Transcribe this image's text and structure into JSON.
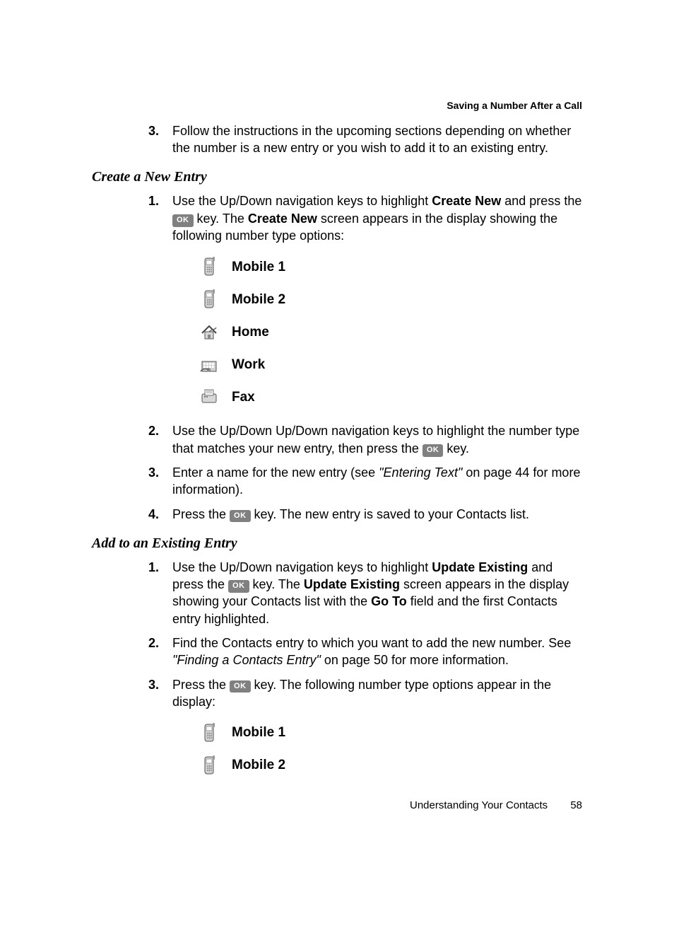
{
  "header": {
    "chapter_title": "Saving a Number After a Call"
  },
  "top_step": {
    "num": "3.",
    "text_before": "Follow the instructions in the upcoming sections depending on whether the number is a new entry or you wish to add it to an existing entry."
  },
  "section_a": {
    "heading": "Create a New Entry",
    "step1": {
      "num": "1.",
      "part1": "Use the Up/Down navigation keys to highlight ",
      "bold1": "Create New",
      "part2": " and press the ",
      "ok": "OK",
      "part3": " key. The ",
      "bold2": "Create New",
      "part4": " screen appears in the display showing the following number type options:"
    },
    "icons": {
      "mobile1": "Mobile 1",
      "mobile2": "Mobile 2",
      "home": "Home",
      "work": "Work",
      "fax": "Fax"
    },
    "step2": {
      "num": "2.",
      "part1": "Use the Up/Down Up/Down navigation keys to highlight the number type that matches your new entry, then press the ",
      "ok": "OK",
      "part2": " key."
    },
    "step3": {
      "num": "3.",
      "part1": "Enter a name for the new entry (see ",
      "ref": "\"Entering Text\"",
      "part2": " on page 44 for more information)."
    },
    "step4": {
      "num": "4.",
      "part1": "Press the ",
      "ok": "OK",
      "part2": " key. The new entry is saved to your Contacts list."
    }
  },
  "section_b": {
    "heading": "Add to an Existing Entry",
    "step1": {
      "num": "1.",
      "part1": "Use the Up/Down navigation keys to highlight ",
      "bold1": "Update Existing",
      "part2": " and press the ",
      "ok": "OK",
      "part3": " key. The ",
      "bold2": "Update Existing",
      "part4": " screen appears in the display showing your Contacts list with the ",
      "bold3": "Go To",
      "part5": " field and the first Contacts entry highlighted."
    },
    "step2": {
      "num": "2.",
      "part1": "Find the Contacts entry to which you want to add the new number. See ",
      "ref": "\"Finding a Contacts Entry\"",
      "part2": " on page 50 for more information."
    },
    "step3": {
      "num": "3.",
      "part1": "Press the ",
      "ok": "OK",
      "part2": " key. The following number type options appear in the display:"
    },
    "icons": {
      "mobile1": "Mobile 1",
      "mobile2": "Mobile 2"
    }
  },
  "footer": {
    "section_name": "Understanding Your Contacts",
    "page_num": "58"
  }
}
